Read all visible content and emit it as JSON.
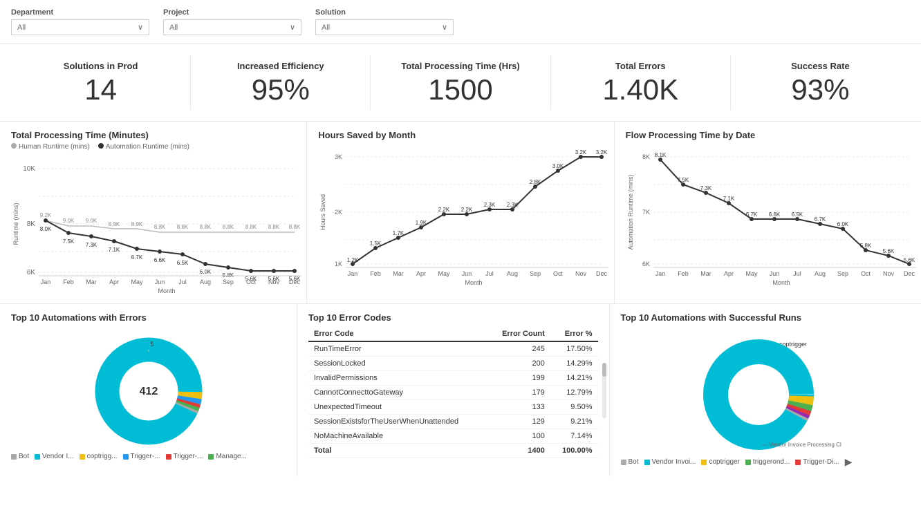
{
  "filters": {
    "department": {
      "label": "Department",
      "value": "All"
    },
    "project": {
      "label": "Project",
      "value": "All"
    },
    "solution": {
      "label": "Solution",
      "value": "All"
    }
  },
  "kpis": [
    {
      "label": "Solutions in Prod",
      "value": "14"
    },
    {
      "label": "Increased Efficiency",
      "value": "95%"
    },
    {
      "label": "Total Processing Time (Hrs)",
      "value": "1500"
    },
    {
      "label": "Total Errors",
      "value": "1.40K"
    },
    {
      "label": "Success Rate",
      "value": "93%"
    }
  ],
  "chart1": {
    "title": "Total Processing Time (Minutes)",
    "legend": [
      {
        "label": "Human Runtime (mins)",
        "color": "#aaa"
      },
      {
        "label": "Automation Runtime (mins)",
        "color": "#333"
      }
    ]
  },
  "chart2": {
    "title": "Hours Saved by Month",
    "xLabel": "Month",
    "yLabel": "Hours Saved"
  },
  "chart3": {
    "title": "Flow Processing Time by Date",
    "xLabel": "Month",
    "yLabel": "Automation Runtime (mins)"
  },
  "errorTable": {
    "title": "Top 10 Error Codes",
    "columns": [
      "Error Code",
      "Error Count",
      "Error %"
    ],
    "rows": [
      {
        "code": "RunTimeError",
        "count": "245",
        "pct": "17.50%"
      },
      {
        "code": "SessionLocked",
        "count": "200",
        "pct": "14.29%"
      },
      {
        "code": "InvalidPermissions",
        "count": "199",
        "pct": "14.21%"
      },
      {
        "code": "CannotConnecttoGateway",
        "count": "179",
        "pct": "12.79%"
      },
      {
        "code": "UnexpectedTimeout",
        "count": "133",
        "pct": "9.50%"
      },
      {
        "code": "SessionExistsforTheUserWhenUnattended",
        "count": "129",
        "pct": "9.21%"
      },
      {
        "code": "NoMachineAvailable",
        "count": "100",
        "pct": "7.14%"
      }
    ],
    "total": {
      "label": "Total",
      "count": "1400",
      "pct": "100.00%"
    }
  },
  "donut1": {
    "title": "Top 10 Automations with Errors",
    "centerLabel": "412",
    "topLabel": "5",
    "legend": [
      {
        "label": "Bot",
        "color": "#999"
      },
      {
        "label": "Vendor I...",
        "color": "#00bcd4"
      },
      {
        "label": "coptrigg...",
        "color": "#f0c010"
      },
      {
        "label": "Trigger-...",
        "color": "#2196f3"
      },
      {
        "label": "Trigger-...",
        "color": "#e53935"
      },
      {
        "label": "Manage...",
        "color": "#4caf50"
      }
    ]
  },
  "donut2": {
    "title": "Top 10 Automations with Successful Runs",
    "topLabel": "coptrigger",
    "legend": [
      {
        "label": "Bot",
        "color": "#999"
      },
      {
        "label": "Vendor Invoi...",
        "color": "#00bcd4"
      },
      {
        "label": "coptrigger",
        "color": "#f0c010"
      },
      {
        "label": "triggerond...",
        "color": "#4caf50"
      },
      {
        "label": "Trigger-Di...",
        "color": "#e53935"
      }
    ],
    "bottomLabel": "Vendor Invoice Processing Cl..."
  },
  "colors": {
    "accent": "#00bcd4",
    "humanLine": "#aaaaaa",
    "autoLine": "#333333"
  }
}
